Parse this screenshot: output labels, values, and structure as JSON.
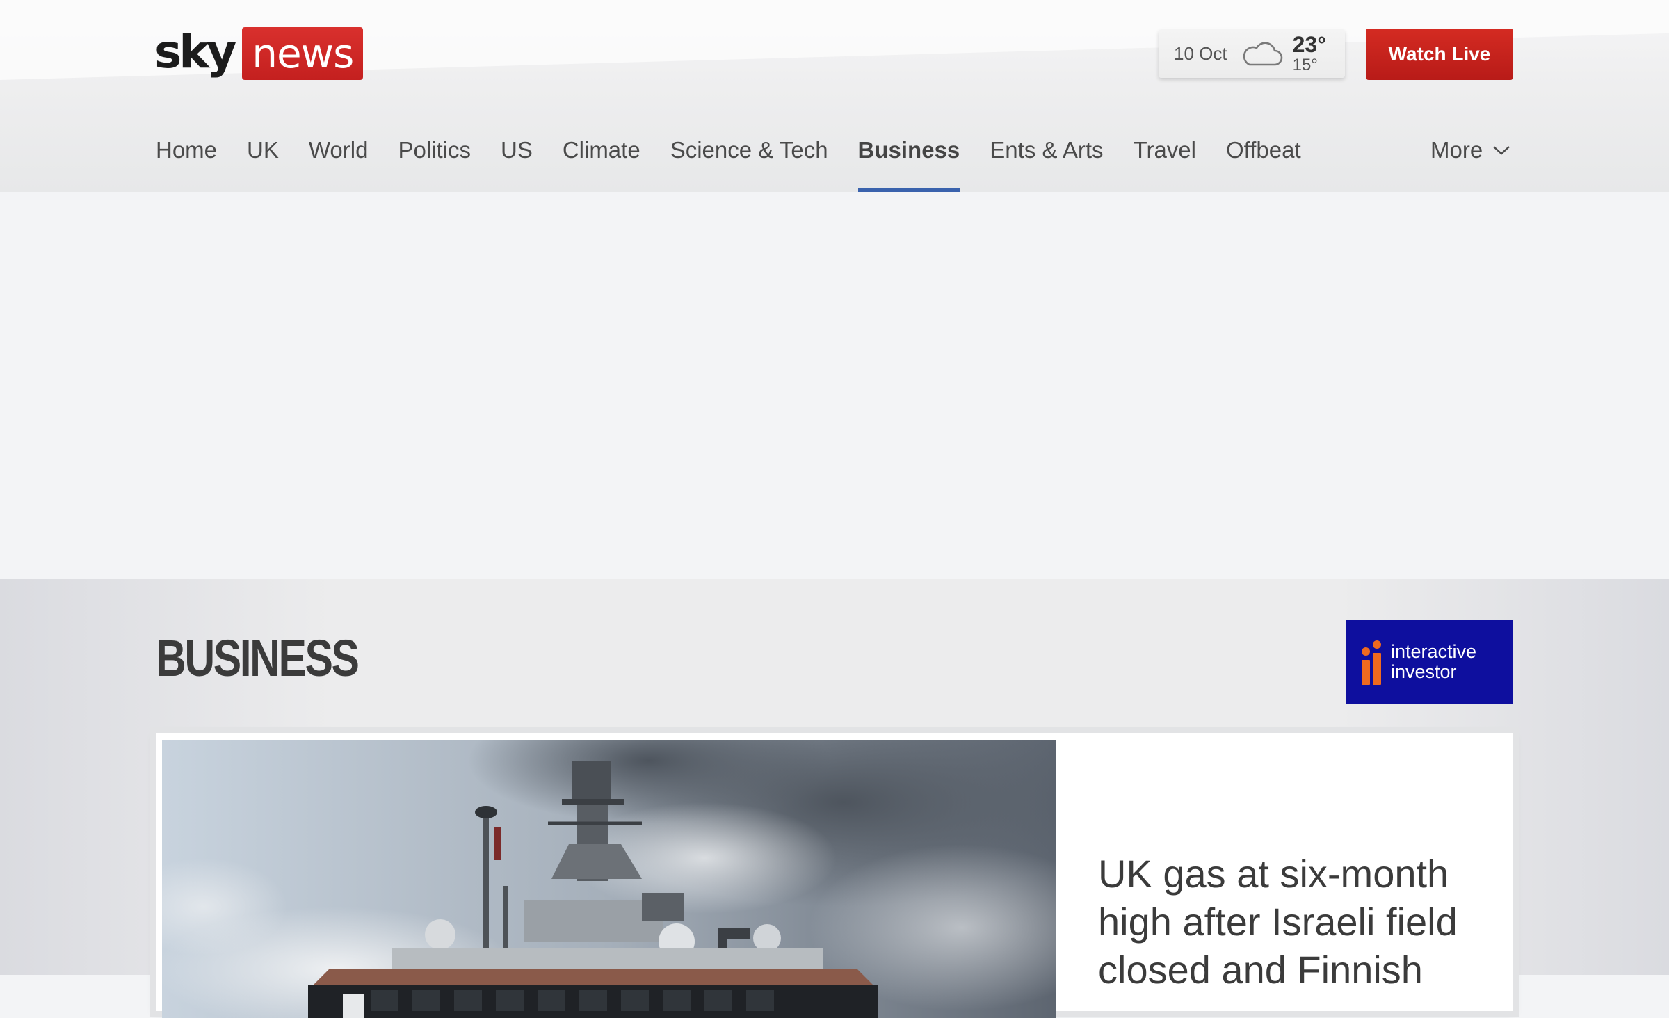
{
  "header": {
    "logo": {
      "sky": "sky",
      "news": "news"
    },
    "weather": {
      "date": "10 Oct",
      "icon": "cloud-icon",
      "high": "23°",
      "low": "15°"
    },
    "watch_live_label": "Watch Live",
    "nav": [
      {
        "label": "Home"
      },
      {
        "label": "UK"
      },
      {
        "label": "World"
      },
      {
        "label": "Politics"
      },
      {
        "label": "US"
      },
      {
        "label": "Climate"
      },
      {
        "label": "Science & Tech"
      },
      {
        "label": "Business",
        "active": true
      },
      {
        "label": "Ents & Arts"
      },
      {
        "label": "Travel"
      },
      {
        "label": "Offbeat"
      }
    ],
    "more_label": "More"
  },
  "section": {
    "title": "BUSINESS",
    "sponsor": {
      "line1": "interactive",
      "line2": "investor"
    }
  },
  "lead_story": {
    "headline": "UK gas at six-month high after Israeli field closed and Finnish"
  },
  "colors": {
    "brand_red": "#c4201f",
    "nav_active_underline": "#3a62ad",
    "sponsor_blue": "#0e0f9e",
    "sponsor_orange": "#ef6a1f"
  }
}
